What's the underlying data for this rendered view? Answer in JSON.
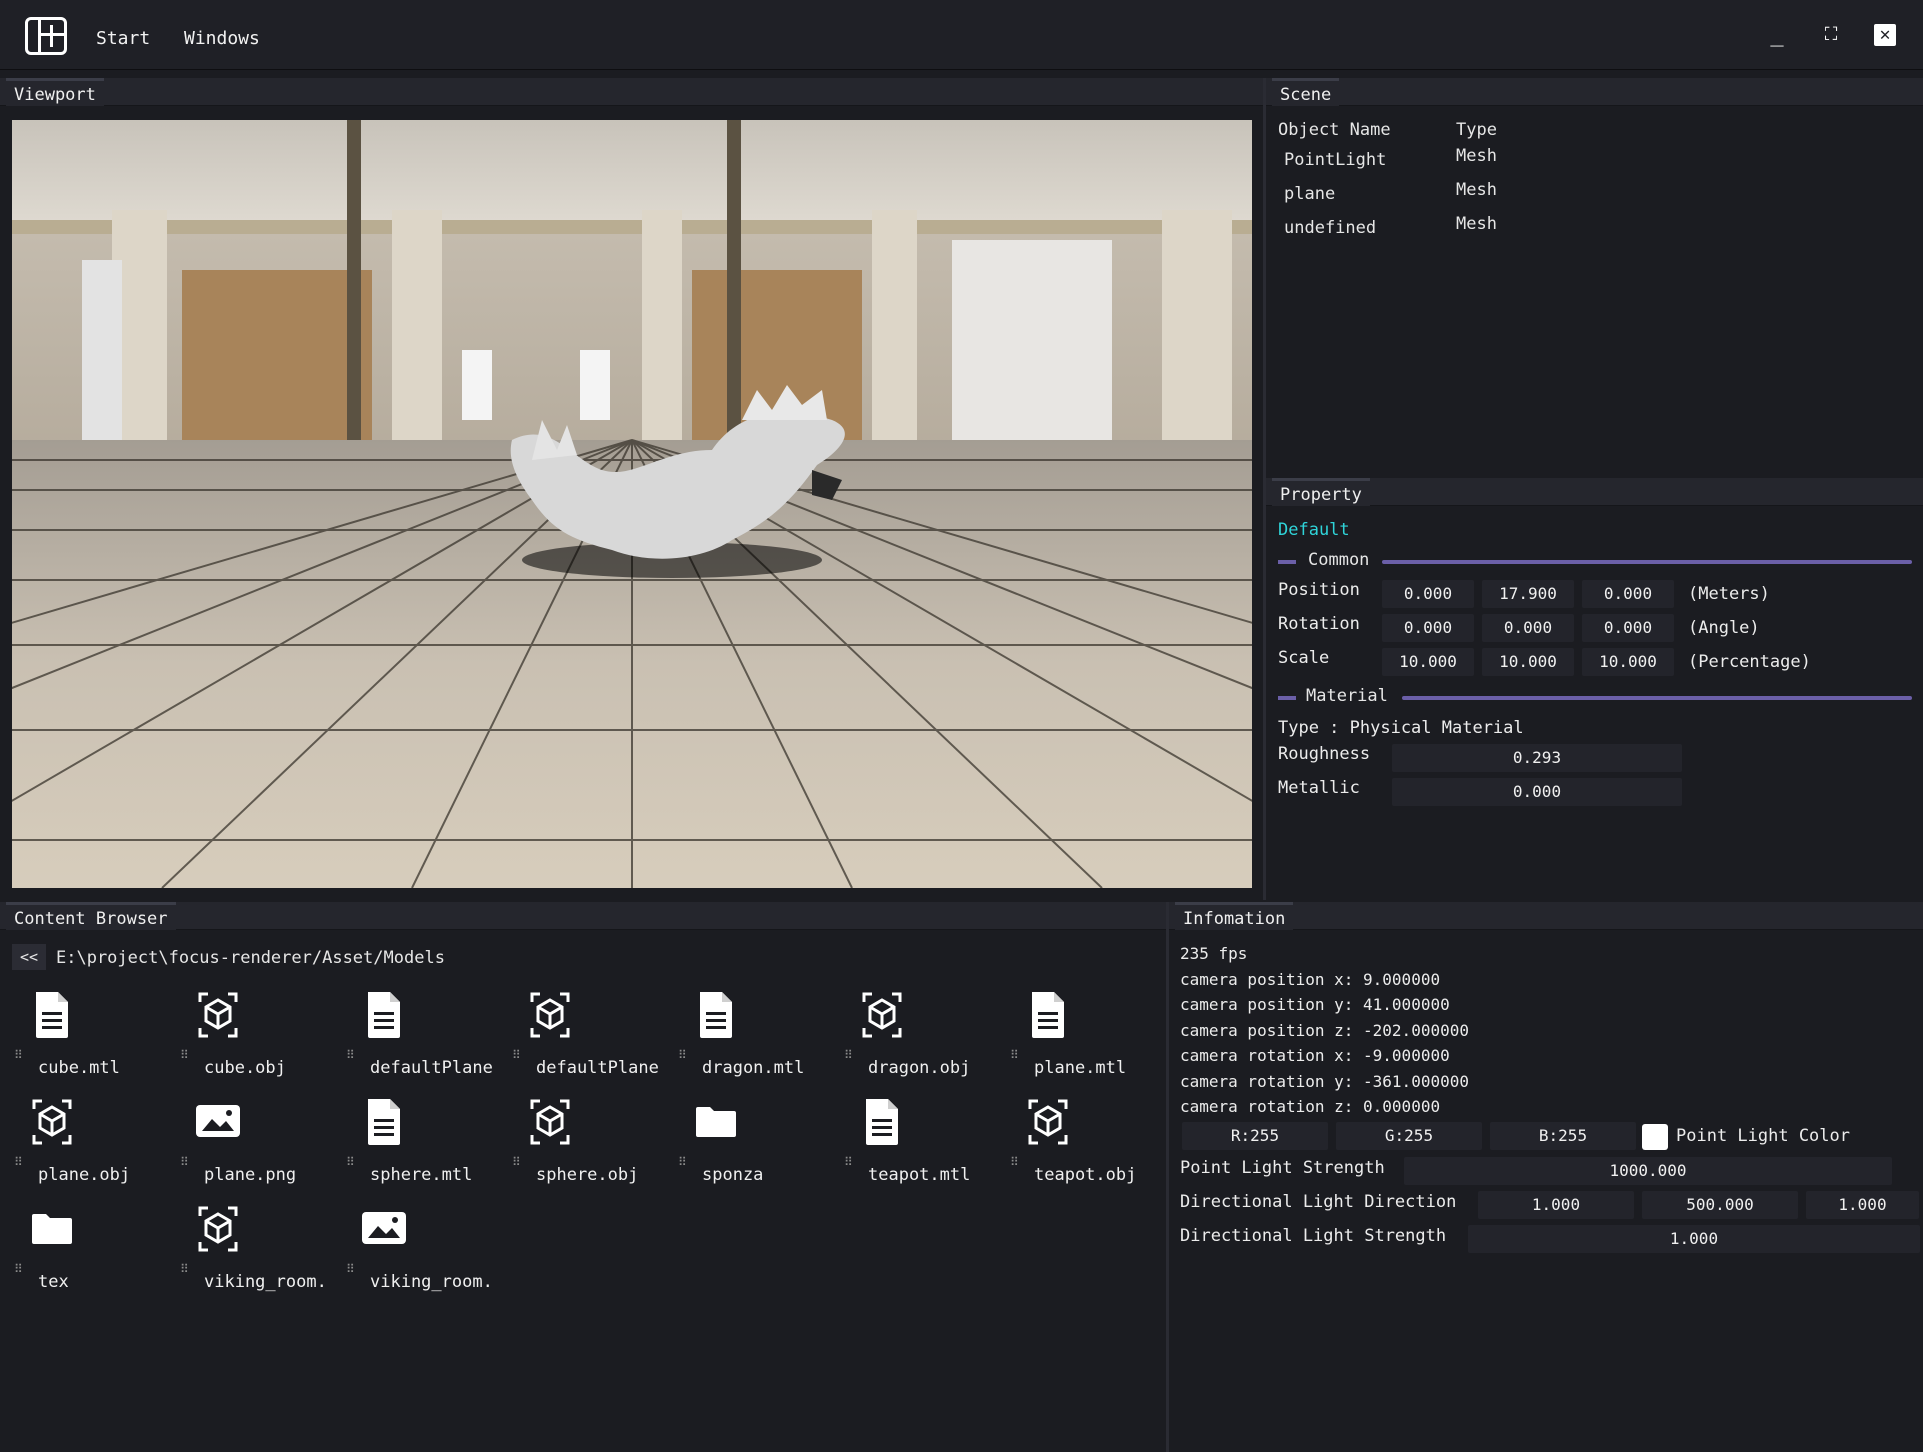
{
  "menu": {
    "start": "Start",
    "windows": "Windows"
  },
  "window_controls": {
    "minimize": "_",
    "maximize": "⛶",
    "close": "✕"
  },
  "viewport": {
    "title": "Viewport"
  },
  "scene": {
    "title": "Scene",
    "col_name": "Object Name",
    "col_type": "Type",
    "rows": [
      {
        "name": "PointLight",
        "type": "Mesh"
      },
      {
        "name": "plane",
        "type": "Mesh"
      },
      {
        "name": "undefined",
        "type": "Mesh"
      }
    ]
  },
  "property": {
    "title": "Property",
    "preset": "Default",
    "common_label": "Common",
    "position_label": "Position",
    "position": [
      "0.000",
      "17.900",
      "0.000"
    ],
    "position_unit": "(Meters)",
    "rotation_label": "Rotation",
    "rotation": [
      "0.000",
      "0.000",
      "0.000"
    ],
    "rotation_unit": "(Angle)",
    "scale_label": "Scale",
    "scale": [
      "10.000",
      "10.000",
      "10.000"
    ],
    "scale_unit": "(Percentage)",
    "material_label": "Material",
    "type_text": "Type : Physical Material",
    "roughness_label": "Roughness",
    "roughness": "0.293",
    "metallic_label": "Metallic",
    "metallic": "0.000"
  },
  "content_browser": {
    "title": "Content Browser",
    "back": "<<",
    "path": "E:\\project\\focus-renderer/Asset/Models",
    "items": [
      {
        "label": "cube.mtl",
        "icon": "document-icon"
      },
      {
        "label": "cube.obj",
        "icon": "cube-icon"
      },
      {
        "label": "defaultPlane",
        "icon": "document-icon"
      },
      {
        "label": "defaultPlane",
        "icon": "cube-icon"
      },
      {
        "label": "dragon.mtl",
        "icon": "document-icon"
      },
      {
        "label": "dragon.obj",
        "icon": "cube-icon"
      },
      {
        "label": "plane.mtl",
        "icon": "document-icon"
      },
      {
        "label": "plane.obj",
        "icon": "cube-icon"
      },
      {
        "label": "plane.png",
        "icon": "image-icon"
      },
      {
        "label": "sphere.mtl",
        "icon": "document-icon"
      },
      {
        "label": "sphere.obj",
        "icon": "cube-icon"
      },
      {
        "label": "sponza",
        "icon": "folder-icon"
      },
      {
        "label": "teapot.mtl",
        "icon": "document-icon"
      },
      {
        "label": "teapot.obj",
        "icon": "cube-icon"
      },
      {
        "label": "tex",
        "icon": "folder-icon"
      },
      {
        "label": "viking_room.",
        "icon": "cube-icon"
      },
      {
        "label": "viking_room.",
        "icon": "image-icon"
      }
    ],
    "hash": "⠿"
  },
  "information": {
    "title": "Infomation",
    "fps": "235 fps",
    "cam_pos_x": "camera position x: 9.000000",
    "cam_pos_y": "camera position y: 41.000000",
    "cam_pos_z": "camera position z: -202.000000",
    "cam_rot_x": "camera rotation x: -9.000000",
    "cam_rot_y": "camera rotation y: -361.000000",
    "cam_rot_z": "camera rotation z: 0.000000",
    "r": "R:255",
    "g": "G:255",
    "b": "B:255",
    "point_light_color_label": "Point Light Color",
    "point_light_color": "#ffffff",
    "point_light_strength_label": "Point Light Strength",
    "point_light_strength": "1000.000",
    "dir_light_direction_label": "Directional Light Direction",
    "dir_light_direction": [
      "1.000",
      "500.000",
      "1.000"
    ],
    "dir_light_strength_label": "Directional Light Strength",
    "dir_light_strength": "1.000"
  },
  "colors": {
    "accent": "#6b5fa8",
    "preset": "#2fd4d9"
  }
}
